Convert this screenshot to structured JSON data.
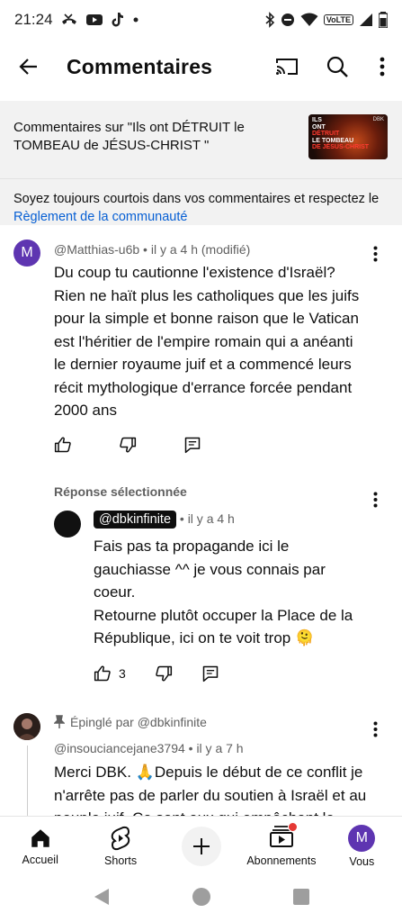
{
  "status_bar": {
    "time": "21:24",
    "volte": "VoLTE"
  },
  "header": {
    "title": "Commentaires"
  },
  "video_info": {
    "text": "Commentaires sur \"Ils ont DÉTRUIT le TOMBEAU de JÉSUS-CHRIST \"",
    "thumb_line1": "ILS",
    "thumb_line2": "ONT",
    "thumb_line3": "DÉTRUIT",
    "thumb_line4": "LE TOMBEAU",
    "thumb_line5": "DE JÉSUS-CHRIST",
    "thumb_brand": "DBK",
    "guidelines_prefix": "Soyez toujours courtois dans vos commentaires et respectez le",
    "guidelines_link": "Règlement de la communauté"
  },
  "comments": [
    {
      "avatar_letter": "M",
      "avatar_color": "#5e35b1",
      "author": "@Matthias-u6b",
      "time": "• il y a 4 h (modifié)",
      "text": "Du coup tu cautionne l'existence d'Israël? Rien ne haït plus les catholiques que les juifs pour la simple et bonne raison que le Vatican est l'héritier de l'empire romain qui a anéanti le dernier royaume juif et a commencé leurs récit mythologique d'errance forcée pendant 2000 ans"
    }
  ],
  "reply_section": {
    "label": "Réponse sélectionnée",
    "author": "@dbkinfinite",
    "time": "• il y a 4 h",
    "text_line1": "Fais pas ta propagande ici le gauchiasse ^^ je vous connais par coeur.",
    "text_line2": "Retourne plutôt occuper la Place de la République, ici on te voit trop 🫠",
    "like_count": "3"
  },
  "pinned_comment": {
    "pinned_label": "Épinglé par @dbkinfinite",
    "author": "@insouciancejane3794",
    "time": "• il y a 7 h",
    "text": "Merci DBK. 🙏Depuis le début de ce conflit je n'arrête pas de parler du soutien à Israël et au peuple juif. Ce sont eux qui empêchent le"
  },
  "bottom_nav": {
    "home": "Accueil",
    "shorts": "Shorts",
    "subscriptions": "Abonnements",
    "you": "Vous",
    "you_letter": "M"
  }
}
